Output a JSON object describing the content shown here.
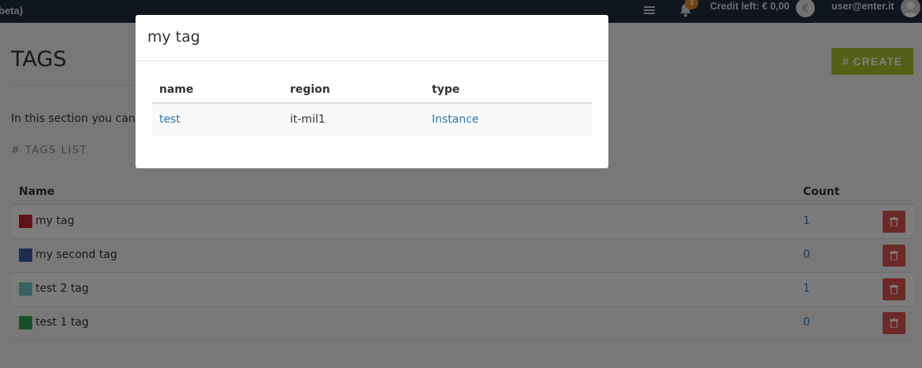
{
  "topbar": {
    "brand": "beta)",
    "notifications_count": "3",
    "credit": "Credit left: € 0,00",
    "coin_symbol": "€",
    "user": "user@enter.it"
  },
  "page": {
    "title": "TAGS",
    "create_label": "CREATE",
    "intro": "In this section you can cr",
    "section_header": "TAGS LIST"
  },
  "tags_table": {
    "headers": {
      "name": "Name",
      "count": "Count"
    },
    "rows": [
      {
        "name": "my tag",
        "color": "#c0262d",
        "count": "1"
      },
      {
        "name": "my second tag",
        "color": "#3a5aa6",
        "count": "0"
      },
      {
        "name": "test 2 tag",
        "color": "#6cc7c4",
        "count": "1"
      },
      {
        "name": "test 1 tag",
        "color": "#2fa04f",
        "count": "0"
      }
    ]
  },
  "modal": {
    "title": "my tag",
    "headers": {
      "name": "name",
      "region": "region",
      "type": "type"
    },
    "rows": [
      {
        "name": "test",
        "region": "it-mil1",
        "type": "Instance"
      }
    ]
  }
}
